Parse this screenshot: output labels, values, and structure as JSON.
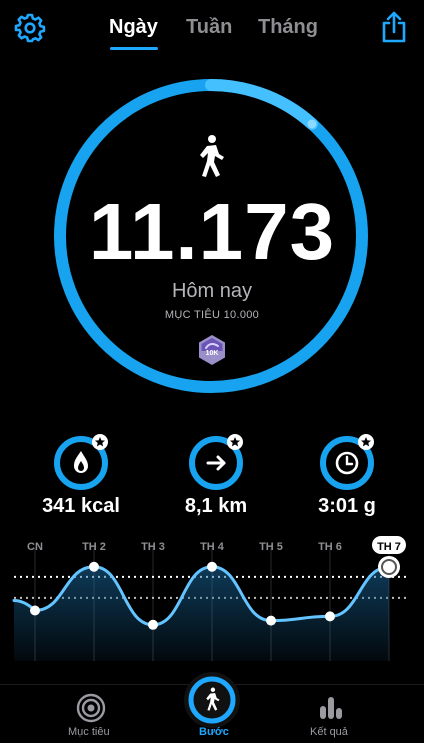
{
  "header": {
    "tabs": [
      {
        "label": "Ngày",
        "active": true
      },
      {
        "label": "Tuần",
        "active": false
      },
      {
        "label": "Tháng",
        "active": false
      }
    ],
    "icons": {
      "left": "gear-icon",
      "right": "share-icon"
    }
  },
  "ring": {
    "steps": "11.173",
    "label": "Hôm nay",
    "goal": "MỤC TIÊU 10.000",
    "badge": "10K",
    "progress_fraction": 1.0
  },
  "stats": [
    {
      "icon": "flame-icon",
      "value": "341 kcal"
    },
    {
      "icon": "arrow-right-icon",
      "value": "8,1 km"
    },
    {
      "icon": "clock-icon",
      "value": "3:01 g"
    }
  ],
  "chart_data": {
    "type": "line",
    "categories": [
      "CN",
      "TH 2",
      "TH 3",
      "TH 4",
      "TH 5",
      "TH 6",
      "TH 7"
    ],
    "selected": "TH 7",
    "values": [
      6000,
      11200,
      4300,
      11200,
      4800,
      5300,
      11173
    ],
    "goal": 10000,
    "midline": 7500,
    "ylim": [
      0,
      12000
    ]
  },
  "bottom_nav": [
    {
      "label": "Mục tiêu",
      "icon": "target-icon",
      "active": false
    },
    {
      "label": "Bước",
      "icon": "walker-icon",
      "active": true
    },
    {
      "label": "Kết quả",
      "icon": "bar-chart-icon",
      "active": false
    }
  ],
  "colors": {
    "accent": "#1fa8ff",
    "accent_light": "#7fd1ff",
    "background": "#000000",
    "muted": "#8e8e93"
  }
}
